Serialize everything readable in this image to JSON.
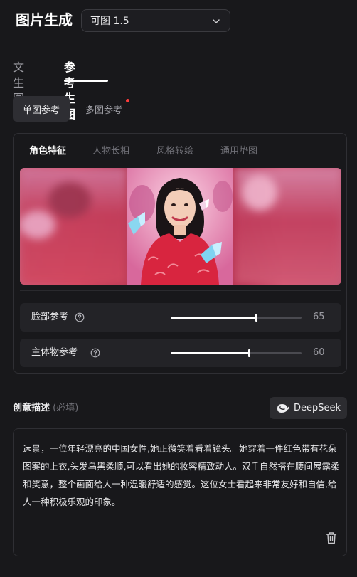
{
  "header": {
    "title": "图片生成",
    "model_select": {
      "value": "可图 1.5"
    }
  },
  "mode_tabs": {
    "items": [
      {
        "label": "文生图",
        "active": false
      },
      {
        "label": "参考生图",
        "active": true
      }
    ]
  },
  "reference_mode": {
    "single_label": "单图参考",
    "multi_label": "多图参考"
  },
  "feature_tabs": {
    "items": [
      {
        "label": "角色特征",
        "active": true
      },
      {
        "label": "人物长相",
        "active": false
      },
      {
        "label": "风格转绘",
        "active": false
      },
      {
        "label": "通用垫图",
        "active": false
      }
    ]
  },
  "sliders": [
    {
      "label": "脸部参考",
      "value": 65,
      "fraction": 0.65
    },
    {
      "label": "主体物参考",
      "value": 60,
      "fraction": 0.6
    }
  ],
  "description": {
    "title": "创意描述",
    "hint": "(必填)",
    "deepseek_label": "DeepSeek",
    "text": "远景，一位年轻漂亮的中国女性,她正微笑着看着镜头。她穿着一件红色带有花朵图案的上衣,头发乌黑柔顺,可以看出她的妆容精致动人。双手自然搭在腰间展露柔和笑意，整个画面给人一种温暖舒适的感觉。这位女士看起来非常友好和自信,给人一种积极乐观的印象。"
  },
  "colors": {
    "background": "#18181b",
    "accent_dot": "#ff3b3b",
    "slider_fill": "#ffffff"
  },
  "icons": [
    "chevron-down-icon",
    "help-circle-icon",
    "deepseek-whale-icon",
    "trash-icon"
  ]
}
